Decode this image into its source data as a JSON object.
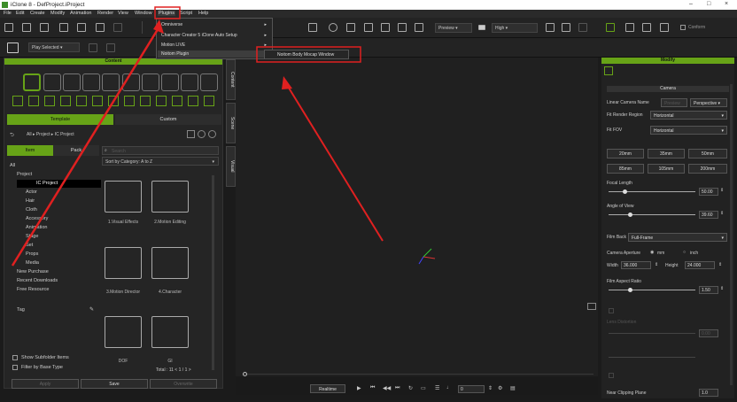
{
  "app": {
    "title": "iClone 8 - DefProject.iProject"
  },
  "menubar": [
    "File",
    "Edit",
    "Create",
    "Modify",
    "Animation",
    "Render",
    "View",
    "Window",
    "Plugins",
    "Script",
    "Help"
  ],
  "plugins_menu": {
    "items": [
      "Omniverse",
      "Character Creator 5 iClone Auto Setup",
      "Motion LIVE",
      "Noitom Plugin"
    ],
    "submenu_item": "Noitom Body Mocap Window"
  },
  "toolbar": {
    "play_mode": "Play Selected",
    "preview": "Preview",
    "quality": "High",
    "conform": "Conform"
  },
  "content_panel": {
    "header": "Content",
    "tabs": [
      "Template",
      "Custom"
    ],
    "breadcrumb": "All ▸ Project ▸ IC Project",
    "subtabs": [
      "Item",
      "Pack"
    ],
    "search_placeholder": "Search",
    "sort": "Sort by Category: A to Z",
    "tree": [
      "All",
      "Project",
      "IC Project",
      "Actor",
      "Hair",
      "Cloth",
      "Accessory",
      "Animation",
      "Stage",
      "Set",
      "Props",
      "Media",
      "New Purchase",
      "Recent Downloads",
      "Free Resource",
      "Tag"
    ],
    "folders": [
      "1.Visual Effects",
      "2.Motion Editing",
      "3.Motion Director",
      "4.Character",
      "DOF",
      "GI"
    ],
    "total": "Total : 11  < 1 / 1 >",
    "checks": [
      "Show Subfolder Items",
      "Filter by Base Type"
    ],
    "buttons": [
      "Apply",
      "Save",
      "Overwrite"
    ]
  },
  "side_tabs": [
    "Content",
    "Scene",
    "Visual"
  ],
  "playback": {
    "realtime": "Realtime",
    "frame": "0"
  },
  "modify_panel": {
    "header": "Modify",
    "section": "Camera",
    "linear_camera_name_label": "Linear Camera Name",
    "linear_camera_name_value": "Preview",
    "projection": "Perspective",
    "fit_render_region_label": "Fit Render Region",
    "fit_render_region_value": "Horizontal",
    "fit_fov_label": "Fit FOV",
    "fit_fov_value": "Horizontal",
    "lenses": [
      "20mm",
      "35mm",
      "50mm",
      "85mm",
      "105mm",
      "200mm"
    ],
    "focal_length_label": "Focal Length",
    "focal_length": "50.00",
    "angle_of_view_label": "Angle of View",
    "angle_of_view": "39.60",
    "film_back_label": "Film Back",
    "film_back": "Full-Frame",
    "aperture_label": "Camera Aperture",
    "unit_mm": "mm",
    "unit_inch": "inch",
    "width_label": "Width",
    "width": "36.000",
    "height_label": "Height",
    "height": "24.000",
    "film_aspect_label": "Film Aspect Ratio",
    "film_aspect": "1.50",
    "lens_distortion": "Lens Distortion",
    "disabled_value": "0.00",
    "clipping_plane_label": "Near Clipping Plane",
    "near_clipping": "1.0"
  },
  "colors": {
    "accent": "#67a317",
    "annotation": "#e02020"
  }
}
